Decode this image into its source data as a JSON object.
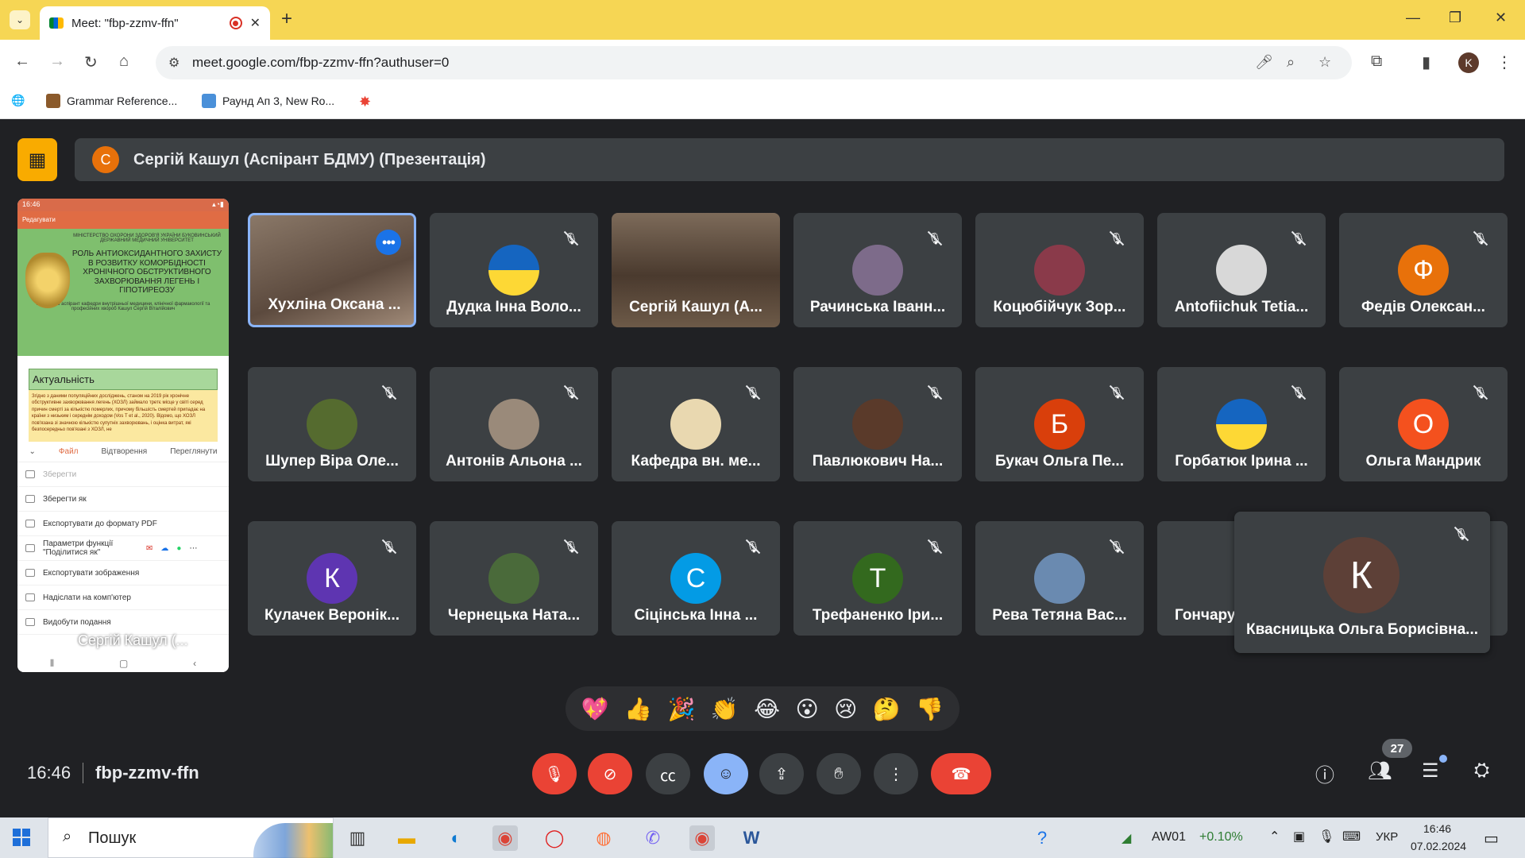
{
  "browser": {
    "tab_title": "Meet: \"fbp-zzmv-ffn\"",
    "url": "meet.google.com/fbp-zzmv-ffn?authuser=0",
    "profile_initial": "K",
    "bookmarks": [
      {
        "label": "Grammar Reference...",
        "color": "#8b5a2b"
      },
      {
        "label": "Раунд Ап 3, New Ro...",
        "color": "#4a90d9"
      },
      {
        "label": "",
        "color": "#fbbc05"
      }
    ]
  },
  "meet": {
    "presenter_initial": "С",
    "presenter_banner": "Сергій Кашул (Аспірант БДМУ) (Презентація)",
    "screen": {
      "status_time": "16:46",
      "app_label": "Редагувати",
      "ministry": "МІНІСТЕРСТВО ОХОРОНИ ЗДОРОВ'Я УКРАЇНИ БУКОВИНСЬКИЙ ДЕРЖАВНИЙ МЕДИЧНИЙ УНІВЕРСИТЕТ",
      "slide_title": "РОЛЬ АНТИОКСИДАНТНОГО ЗАХИСТУ В РОЗВИТКУ КОМОРБІДНОСТІ ХРОНІЧНОГО ОБСТРУКТИВНОГО ЗАХВОРЮВАННЯ ЛЕГЕНЬ І ГІПОТИРЕОЗУ",
      "slide_sub": "Підготував аспірант кафедри внутрішньої медицини, клінічної фармакології та професійних хвороб Кашул Сергій Віталійович",
      "slide2_header": "Актуальність",
      "slide2_body": "Згідно з даними популяційних досліджень, станом на 2019 рік хронічне обструктивне захворювання легень (ХОЗЛ) займало третє місце у світі серед причин смерті за кількістю померлих, причому більшість смертей припадає на країни з низьким і середнім доходом (Vos T et al., 2020). Відомо, що ХОЗЛ пов'язана зі значною кількістю супутніх захворювань, і оцінка витрат, які безпосередньо пов'язані з ХОЗЛ, не",
      "sheet_tabs": [
        "Файл",
        "Відтворення",
        "Переглянути"
      ],
      "menu": [
        "Зберегти",
        "Зберегти як",
        "Експортувати до формату PDF",
        "Параметри функції \"Поділитися як\"",
        "Експортувати зображення",
        "Надіслати на комп'ютер",
        "Видобути подання"
      ],
      "owner_name": "Сергій Кашул (..."
    },
    "participants": [
      {
        "name": "Хухліна Оксана ...",
        "type": "video",
        "active": true
      },
      {
        "name": "Дудка Інна Воло...",
        "type": "avatar",
        "avatar": "",
        "color": "flag"
      },
      {
        "name": "Сергій Кашул (А...",
        "type": "video2"
      },
      {
        "name": "Рачинська Іванн...",
        "type": "avatar",
        "avatar": "",
        "color": "#7d6b8a"
      },
      {
        "name": "Коцюбійчук Зор...",
        "type": "avatar",
        "avatar": "",
        "color": "#8a3a4a"
      },
      {
        "name": "Antofiichuk Tetia...",
        "type": "avatar",
        "avatar": "",
        "color": "#d8d8d8"
      },
      {
        "name": "Федів Олексан...",
        "type": "avatar",
        "avatar": "Ф",
        "color": "#e8710a"
      },
      {
        "name": "Шупер Віра Оле...",
        "type": "avatar",
        "avatar": "",
        "color": "#556b2f"
      },
      {
        "name": "Антонів Альона ...",
        "type": "avatar",
        "avatar": "",
        "color": "#9a8a7a"
      },
      {
        "name": "Кафедра вн. ме...",
        "type": "avatar",
        "avatar": "",
        "color": "#e9d8b0"
      },
      {
        "name": "Павлюкович На...",
        "type": "avatar",
        "avatar": "",
        "color": "#5a3a2a"
      },
      {
        "name": "Букач Ольга Пе...",
        "type": "avatar",
        "avatar": "Б",
        "color": "#d93f0b"
      },
      {
        "name": "Горбатюк Ірина ...",
        "type": "avatar",
        "avatar": "",
        "color": "flag"
      },
      {
        "name": "Ольга Мандрик",
        "type": "avatar",
        "avatar": "О",
        "color": "#f4511e"
      },
      {
        "name": "Кулачек Веронік...",
        "type": "avatar",
        "avatar": "К",
        "color": "#5e35b1"
      },
      {
        "name": "Чернецька Ната...",
        "type": "avatar",
        "avatar": "",
        "color": "#4a6a3a"
      },
      {
        "name": "Сіцінська Інна ...",
        "type": "avatar",
        "avatar": "С",
        "color": "#039be5"
      },
      {
        "name": "Трефаненко Іри...",
        "type": "avatar",
        "avatar": "Т",
        "color": "#33691e"
      },
      {
        "name": "Рева Тетяна Вас...",
        "type": "avatar",
        "avatar": "",
        "color": "#6a8ab0"
      },
      {
        "name": "Гончару",
        "type": "avatar",
        "avatar": "",
        "color": "#3c4043"
      }
    ],
    "spotlight": {
      "name": "Квасницька Ольга Борисівна...",
      "avatar": "К"
    },
    "reactions": [
      "💖",
      "👍",
      "🎉",
      "👏",
      "😂",
      "😮",
      "😢",
      "🤔",
      "👎"
    ],
    "clock": "16:46",
    "meeting_code": "fbp-zzmv-ffn",
    "participant_count": "27"
  },
  "taskbar": {
    "search_label": "Пошук",
    "stock_name": "AW01",
    "stock_change": "+0.10%",
    "lang": "УКР",
    "time": "16:46",
    "date": "07.02.2024"
  }
}
